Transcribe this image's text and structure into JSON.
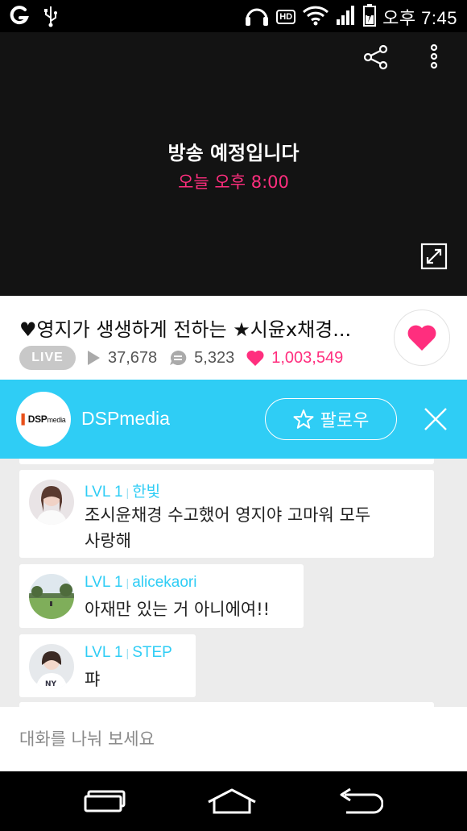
{
  "status_bar": {
    "time": "오후 7:45",
    "hd_label": "HD",
    "icons": [
      "g-logo-icon",
      "usb-icon",
      "headphones-icon",
      "hd-voice-icon",
      "wifi-icon",
      "signal-icon",
      "battery-charging-icon"
    ]
  },
  "video": {
    "title": "방송 예정입니다",
    "scheduled_time": "오늘 오후 8:00",
    "icons": [
      "share-icon",
      "more-icon",
      "fullscreen-icon"
    ]
  },
  "broadcast": {
    "title": "♥영지가 생생하게 전하는 ★시윤x채경...",
    "live_badge": "LIVE",
    "views": "37,678",
    "comments": "5,323",
    "hearts": "1,003,549"
  },
  "channel": {
    "logo_text_main": "DSP",
    "logo_text_sub": "media",
    "name": "DSPmedia",
    "follow_label": "팔로우"
  },
  "chat": {
    "messages": [
      {
        "level": "LVL 1",
        "user": "한빛",
        "text_line1": "조시윤채경 수고했어 영지야 고마워 모두",
        "text_line2": "사랑해"
      },
      {
        "level": "LVL 1",
        "user": "alicekaori",
        "text_line1": "아재만 있는 거 아니에여!!"
      },
      {
        "level": "LVL 1",
        "user": "STEP",
        "text_line1": "퍄"
      }
    ]
  },
  "input": {
    "placeholder": "대화를 나눠 보세요"
  },
  "colors": {
    "accent_pink": "#ff2e7e",
    "channel_blue": "#2fcdf5",
    "video_bg": "#131313"
  }
}
